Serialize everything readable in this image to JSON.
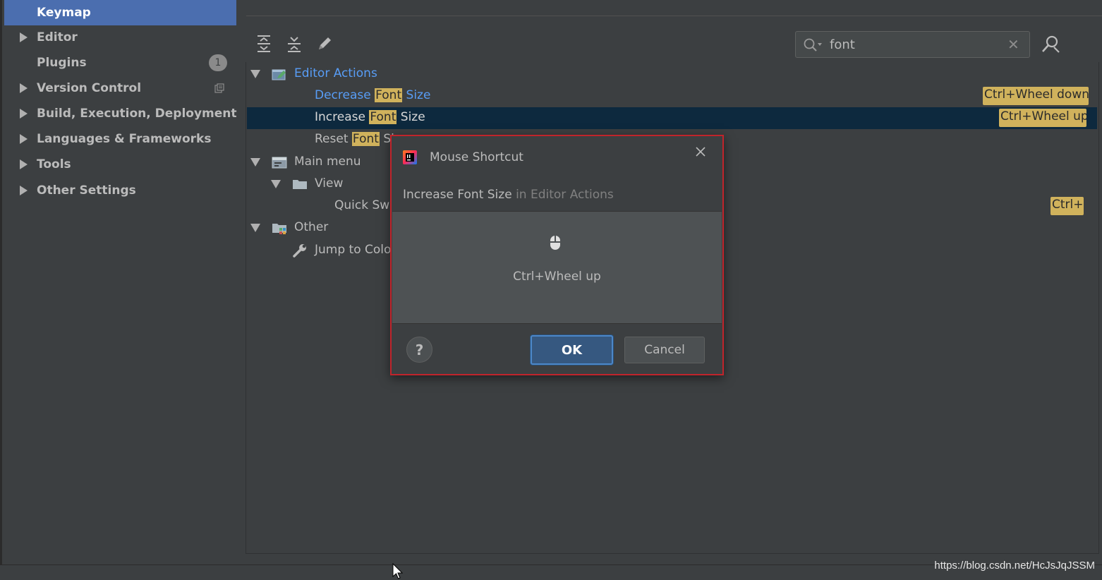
{
  "sidebar": {
    "items": [
      {
        "label": "Keymap",
        "selected": true,
        "expandable": false
      },
      {
        "label": "Editor",
        "selected": false,
        "expandable": true
      },
      {
        "label": "Plugins",
        "selected": false,
        "expandable": false,
        "badge": "1"
      },
      {
        "label": "Version Control",
        "selected": false,
        "expandable": true
      },
      {
        "label": "Build, Execution, Deployment",
        "selected": false,
        "expandable": true
      },
      {
        "label": "Languages & Frameworks",
        "selected": false,
        "expandable": true
      },
      {
        "label": "Tools",
        "selected": false,
        "expandable": true
      },
      {
        "label": "Other Settings",
        "selected": false,
        "expandable": true
      }
    ]
  },
  "search": {
    "value": "font"
  },
  "tree": {
    "editor_actions": "Editor Actions",
    "decrease": {
      "pre": "Decrease ",
      "hl": "Font",
      "post": " Size",
      "shortcut": "Ctrl+Wheel down"
    },
    "increase": {
      "pre": "Increase ",
      "hl": "Font",
      "post": " Size",
      "shortcut": "Ctrl+Wheel up"
    },
    "reset": {
      "pre": "Reset ",
      "hl": "Font",
      "post": " Si"
    },
    "main_menu": "Main menu",
    "view": "View",
    "quick_switch": {
      "text": "Quick Swi",
      "shortcut": "Ctrl+"
    },
    "other": "Other",
    "jump": "Jump to Colo"
  },
  "dialog": {
    "title": "Mouse Shortcut",
    "action_name": "Increase Font Size",
    "action_context": " in Editor Actions",
    "shortcut": "Ctrl+Wheel up",
    "help_label": "?",
    "ok_label": "OK",
    "cancel_label": "Cancel"
  },
  "watermark": "https://blog.csdn.net/HcJsJqJSSM",
  "colors": {
    "selection": "#4b6eaf",
    "highlight": "#d0b25c",
    "link_blue": "#589df6",
    "dialog_border": "#c0242b"
  }
}
